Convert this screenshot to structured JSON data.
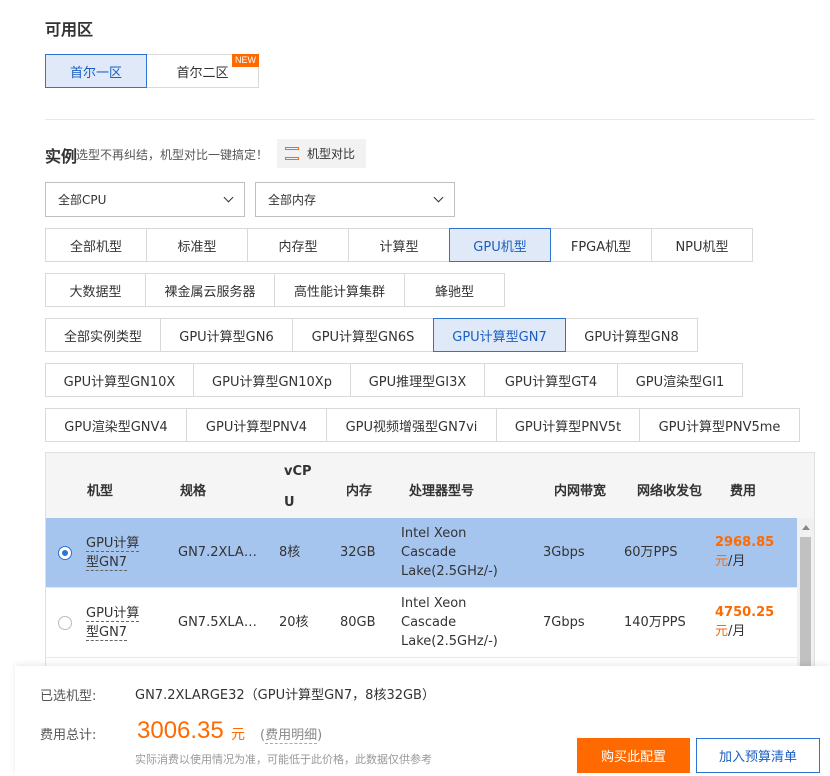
{
  "zone": {
    "title": "可用区",
    "options": [
      {
        "label": "首尔一区",
        "active": true
      },
      {
        "label": "首尔二区",
        "badge": "NEW"
      }
    ]
  },
  "instance": {
    "title": "实例",
    "subtitle": "选型不再纠结，机型对比一键搞定！",
    "compare_label": "机型对比",
    "cpu_select": "全部CPU",
    "mem_select": "全部内存",
    "families_row1": [
      "全部机型",
      "标准型",
      "内存型",
      "计算型",
      "GPU机型",
      "FPGA机型",
      "NPU机型"
    ],
    "families_row2": [
      "大数据型",
      "裸金属云服务器",
      "高性能计算集群",
      "蜂驰型"
    ],
    "families_active": "GPU机型",
    "types_row1": [
      "全部实例类型",
      "GPU计算型GN6",
      "GPU计算型GN6S",
      "GPU计算型GN7",
      "GPU计算型GN8"
    ],
    "types_row2": [
      "GPU计算型GN10X",
      "GPU计算型GN10Xp",
      "GPU推理型GI3X",
      "GPU计算型GT4",
      "GPU渲染型GI1"
    ],
    "types_row3": [
      "GPU渲染型GNV4",
      "GPU计算型PNV4",
      "GPU视频增强型GN7vi",
      "GPU计算型PNV5t",
      "GPU计算型PNV5me"
    ],
    "types_active": "GPU计算型GN7"
  },
  "table": {
    "headers": {
      "model": "机型",
      "spec": "规格",
      "vcpu_a": "vCP",
      "vcpu_b": "U",
      "memory": "内存",
      "processor": "处理器型号",
      "bandwidth": "内网带宽",
      "pps": "网络收发包",
      "cost": "费用"
    },
    "rows": [
      {
        "model_a": "GPU计算",
        "model_b": "型GN7",
        "spec": "GN7.2XLA…",
        "vcpu": "8核",
        "memory": "32GB",
        "proc_a": "Intel Xeon",
        "proc_b": "Cascade",
        "proc_c": "Lake(2.5GHz/-)",
        "bandwidth": "3Gbps",
        "pps": "60万PPS",
        "price": "2968.85",
        "yuan": "元",
        "per": "/月",
        "selected": true
      },
      {
        "model_a": "GPU计算",
        "model_b": "型GN7",
        "spec": "GN7.5XLA…",
        "vcpu": "20核",
        "memory": "80GB",
        "proc_a": "Intel Xeon",
        "proc_b": "Cascade",
        "proc_c": "Lake(2.5GHz/-)",
        "bandwidth": "7Gbps",
        "pps": "140万PPS",
        "price": "4750.25",
        "yuan": "元",
        "per": "/月",
        "selected": false
      }
    ]
  },
  "footer": {
    "selected_label": "已选机型:",
    "selected_value": "GN7.2XLARGE32（GPU计算型GN7，8核32GB）",
    "total_label": "费用总计:",
    "total_price": "3006.35",
    "yuan": "元",
    "detail_open": "(",
    "detail_link": "费用明细",
    "detail_close": ")",
    "note": "实际消费以使用情况为准，可能低于此价格，此数据仅供参考",
    "buy_label": "购买此配置",
    "budget_label": "加入预算清单"
  },
  "colors": {
    "accent": "#ff6a00",
    "primary": "#2c73d2",
    "selected_row": "#a5c5ef"
  }
}
